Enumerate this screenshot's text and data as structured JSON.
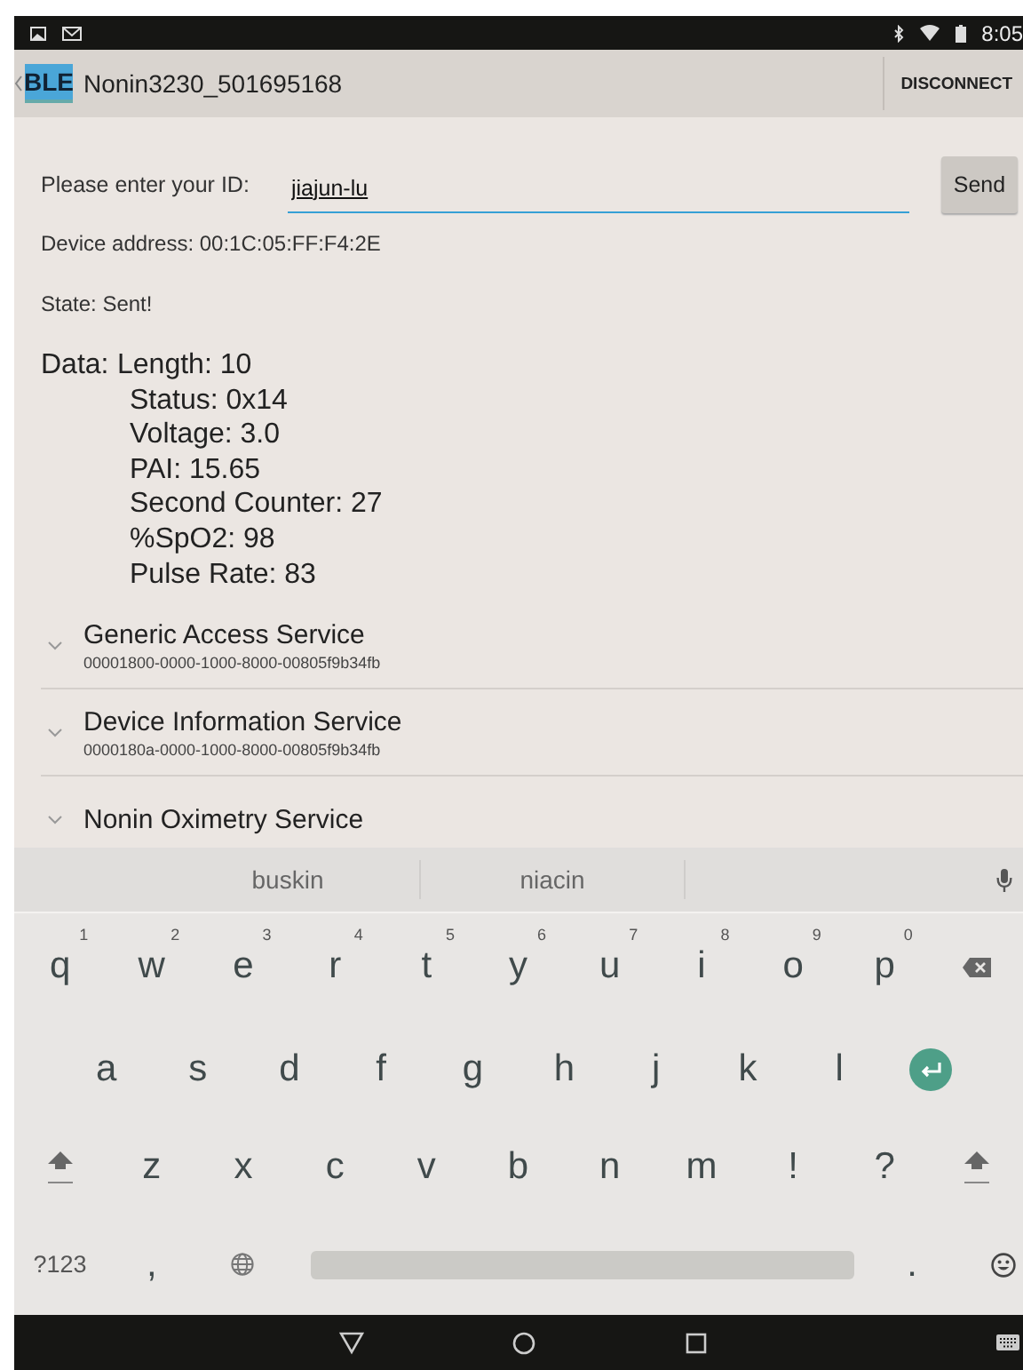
{
  "status_bar": {
    "time": "8:05"
  },
  "action_bar": {
    "logo": "BLE",
    "title": "Nonin3230_501695168",
    "action": "DISCONNECT"
  },
  "id_form": {
    "label": "Please enter your ID:",
    "value": "jiajun-lu",
    "button": "Send"
  },
  "info": [
    {
      "text": "Device address: 00:1C:05:FF:F4:2E"
    },
    {
      "text": "State: Sent!"
    }
  ],
  "data": {
    "label": "Data:",
    "lines": [
      "Length: 10",
      "Status: 0x14",
      "Voltage: 3.0",
      "PAI: 15.65",
      "Second Counter: 27",
      "%SpO2: 98",
      "Pulse Rate: 83"
    ]
  },
  "services": [
    {
      "name": "Generic Access Service",
      "uuid": "00001800-0000-1000-8000-00805f9b34fb",
      "expanded": false
    },
    {
      "name": "Device Information Service",
      "uuid": "0000180a-0000-1000-8000-00805f9b34fb",
      "expanded": false
    },
    {
      "name": "Nonin Oximetry Service",
      "expanded": false
    }
  ],
  "keyboard": {
    "suggestions": [
      "buskin",
      "niacin"
    ],
    "rows": [
      [
        {
          "kind": "letter",
          "label": "q",
          "hint": "1"
        },
        {
          "kind": "letter",
          "label": "w",
          "hint": "2"
        },
        {
          "kind": "letter",
          "label": "e",
          "hint": "3"
        },
        {
          "kind": "letter",
          "label": "r",
          "hint": "4"
        },
        {
          "kind": "letter",
          "label": "t",
          "hint": "5"
        },
        {
          "kind": "letter",
          "label": "y",
          "hint": "6"
        },
        {
          "kind": "letter",
          "label": "u",
          "hint": "7"
        },
        {
          "kind": "letter",
          "label": "i",
          "hint": "8"
        },
        {
          "kind": "letter",
          "label": "o",
          "hint": "9"
        },
        {
          "kind": "letter",
          "label": "p",
          "hint": "0"
        },
        {
          "kind": "backspace"
        }
      ],
      [
        {
          "kind": "gap"
        },
        {
          "kind": "letter",
          "label": "a"
        },
        {
          "kind": "letter",
          "label": "s"
        },
        {
          "kind": "letter",
          "label": "d"
        },
        {
          "kind": "letter",
          "label": "f"
        },
        {
          "kind": "letter",
          "label": "g"
        },
        {
          "kind": "letter",
          "label": "h"
        },
        {
          "kind": "letter",
          "label": "j"
        },
        {
          "kind": "letter",
          "label": "k"
        },
        {
          "kind": "letter",
          "label": "l"
        },
        {
          "kind": "enter"
        }
      ],
      [
        {
          "kind": "shift"
        },
        {
          "kind": "letter",
          "label": "z"
        },
        {
          "kind": "letter",
          "label": "x"
        },
        {
          "kind": "letter",
          "label": "c"
        },
        {
          "kind": "letter",
          "label": "v"
        },
        {
          "kind": "letter",
          "label": "b"
        },
        {
          "kind": "letter",
          "label": "n"
        },
        {
          "kind": "letter",
          "label": "m"
        },
        {
          "kind": "letter",
          "label": "!"
        },
        {
          "kind": "letter",
          "label": "?"
        },
        {
          "kind": "shift"
        }
      ],
      [
        {
          "kind": "symbols",
          "label": "?123"
        },
        {
          "kind": "letter",
          "label": ","
        },
        {
          "kind": "globe"
        },
        {
          "kind": "space"
        },
        {
          "kind": "letter",
          "label": "."
        },
        {
          "kind": "emoji"
        }
      ]
    ]
  }
}
